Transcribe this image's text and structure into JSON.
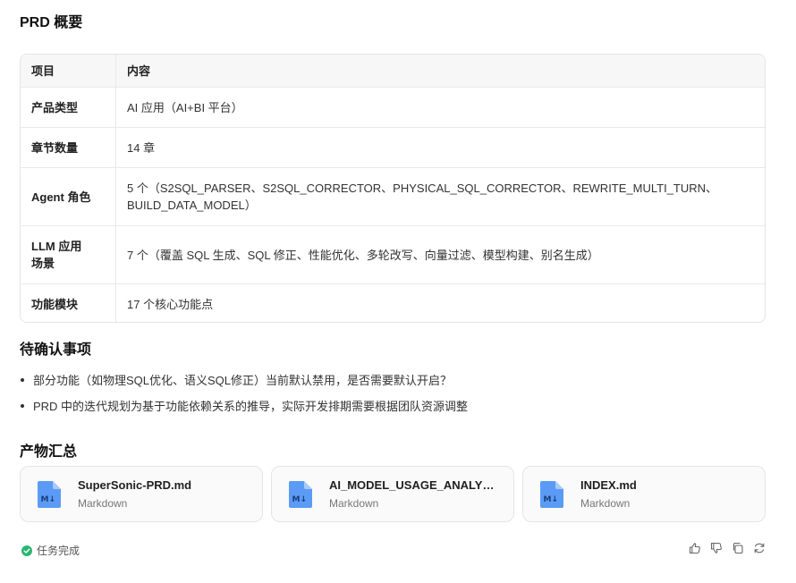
{
  "overview": {
    "title": "PRD 概要",
    "header": {
      "key": "项目",
      "value": "内容"
    },
    "rows": [
      {
        "key": "产品类型",
        "value": "AI 应用（AI+BI 平台）"
      },
      {
        "key": "章节数量",
        "value": "14 章"
      },
      {
        "key": "Agent 角色",
        "value": "5 个（S2SQL_PARSER、S2SQL_CORRECTOR、PHYSICAL_SQL_CORRECTOR、REWRITE_MULTI_TURN、BUILD_DATA_MODEL）"
      },
      {
        "key": "LLM 应用场景",
        "value": "7 个（覆盖 SQL 生成、SQL 修正、性能优化、多轮改写、向量过滤、模型构建、别名生成）"
      },
      {
        "key": "功能模块",
        "value": "17 个核心功能点"
      }
    ]
  },
  "pending": {
    "title": "待确认事项",
    "items": [
      "部分功能（如物理SQL优化、语义SQL修正）当前默认禁用，是否需要默认开启？",
      "PRD 中的迭代规划为基于功能依赖关系的推导，实际开发排期需要根据团队资源调整"
    ]
  },
  "artifacts": {
    "title": "产物汇总",
    "files": [
      {
        "name": "SuperSonic-PRD.md",
        "type": "Markdown"
      },
      {
        "name": "AI_MODEL_USAGE_ANALYSIS.md",
        "type": "Markdown"
      },
      {
        "name": "INDEX.md",
        "type": "Markdown"
      }
    ]
  },
  "footer": {
    "status": "任务完成",
    "icons": [
      "thumbs-up-icon",
      "thumbs-down-icon",
      "copy-icon",
      "regenerate-icon"
    ]
  },
  "colors": {
    "accent_green": "#2bb673",
    "file_icon_blue": "#5b9bf5"
  }
}
